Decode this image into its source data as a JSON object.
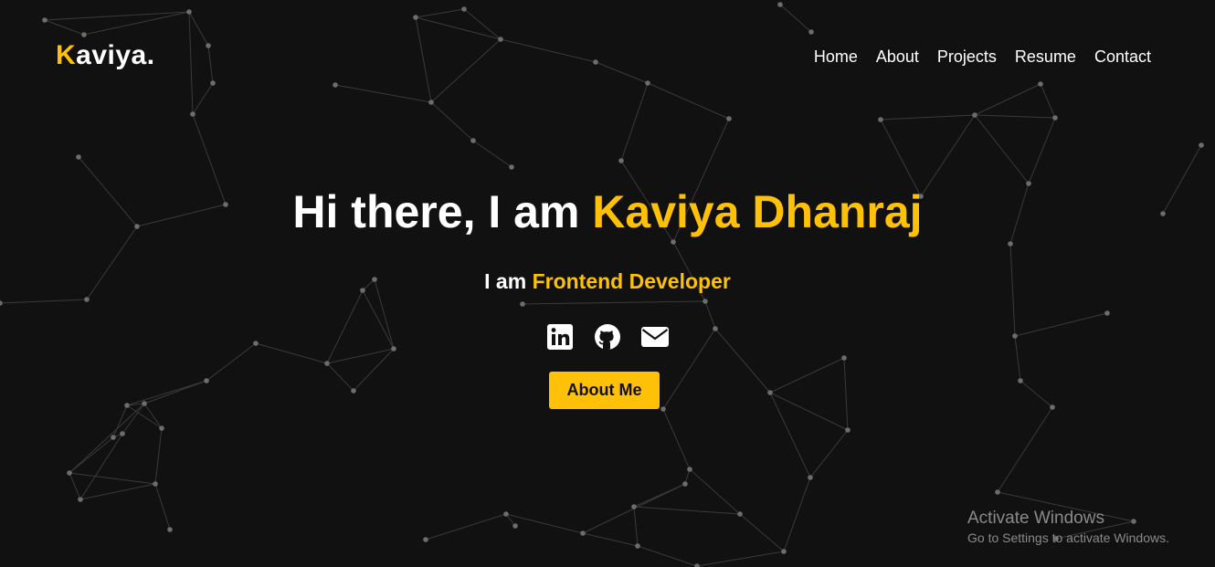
{
  "brand": {
    "initial": "K",
    "rest": "aviya."
  },
  "nav": {
    "items": [
      {
        "label": "Home"
      },
      {
        "label": "About"
      },
      {
        "label": "Projects"
      },
      {
        "label": "Resume"
      },
      {
        "label": "Contact"
      }
    ]
  },
  "hero": {
    "greeting": "Hi there, I am ",
    "name": "Kaviya Dhanraj",
    "subtitle_prefix": "I am ",
    "role": "Frontend Developer",
    "socials": [
      {
        "icon": "linkedin-icon"
      },
      {
        "icon": "github-icon"
      },
      {
        "icon": "envelope-icon"
      }
    ],
    "cta_label": "About Me"
  },
  "watermark": {
    "title": "Activate Windows",
    "subtitle": "Go to Settings to activate Windows."
  },
  "colors": {
    "background": "#111112",
    "accent": "#ffc107",
    "text": "#ffffff",
    "network_line": "#3a3a3a",
    "network_node": "#6d6d6d"
  }
}
